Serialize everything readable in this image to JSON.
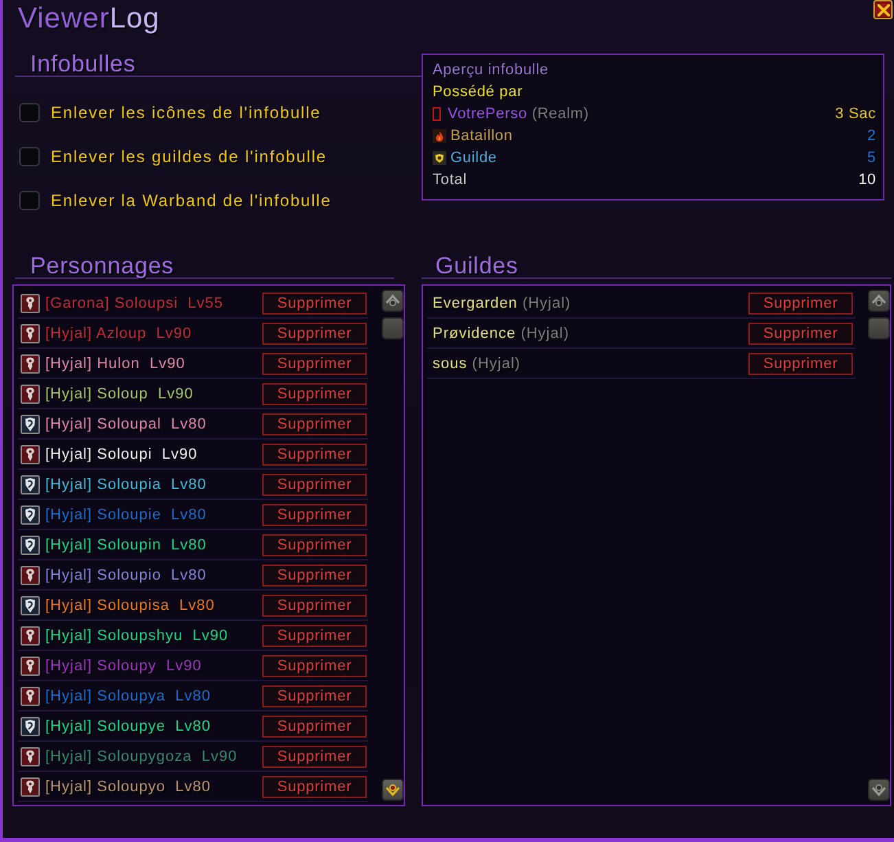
{
  "window": {
    "title": {
      "prefix": "Viewer",
      "suffix": "Log"
    }
  },
  "tooltip_options": {
    "heading": "Infobulles",
    "options": [
      {
        "label": "Enlever les icônes de l'infobulle",
        "checked": false
      },
      {
        "label": "Enlever les guildes de l'infobulle",
        "checked": false
      },
      {
        "label": "Enlever la Warband de l'infobulle",
        "checked": false
      }
    ]
  },
  "tooltip_preview": {
    "title": "Aperçu infobulle",
    "owned_by_label": "Possédé par",
    "rows": [
      {
        "kind": "character",
        "name": "VotrePerso",
        "realm": "(Realm)",
        "value": "3 Sac"
      },
      {
        "kind": "warband",
        "name": "Bataillon",
        "value": "2"
      },
      {
        "kind": "guild",
        "name": "Guilde",
        "value": "5"
      },
      {
        "kind": "total",
        "name": "Total",
        "value": "10"
      }
    ]
  },
  "characters": {
    "heading": "Personnages",
    "scroll_up": {
      "disabled": true
    },
    "scroll_down": {
      "disabled": false
    },
    "rows": [
      {
        "kind": "horde",
        "label": "[Garona] Soloupsi  Lv55",
        "color": "#c8283c",
        "button": "Supprimer"
      },
      {
        "kind": "horde",
        "label": "[Hyjal] Azloup  Lv90",
        "color": "#c8283c",
        "button": "Supprimer"
      },
      {
        "kind": "horde",
        "label": "[Hyjal] Hulon  Lv90",
        "color": "#e483b4",
        "button": "Supprimer"
      },
      {
        "kind": "horde",
        "label": "[Hyjal] Soloup  Lv90",
        "color": "#a2c964",
        "button": "Supprimer"
      },
      {
        "kind": "alliance",
        "label": "[Hyjal] Soloupal  Lv80",
        "color": "#e483b4",
        "button": "Supprimer"
      },
      {
        "kind": "horde",
        "label": "[Hyjal] Soloupi  Lv90",
        "color": "#f0f0f0",
        "button": "Supprimer"
      },
      {
        "kind": "alliance",
        "label": "[Hyjal] Soloupia  Lv80",
        "color": "#38bde4",
        "button": "Supprimer"
      },
      {
        "kind": "alliance",
        "label": "[Hyjal] Soloupie  Lv80",
        "color": "#116fd8",
        "button": "Supprimer"
      },
      {
        "kind": "alliance",
        "label": "[Hyjal] Soloupin  Lv80",
        "color": "#12d88e",
        "button": "Supprimer"
      },
      {
        "kind": "horde",
        "label": "[Hyjal] Soloupio  Lv80",
        "color": "#8283e2",
        "button": "Supprimer"
      },
      {
        "kind": "alliance",
        "label": "[Hyjal] Soloupisa  Lv80",
        "color": "#f07614",
        "button": "Supprimer"
      },
      {
        "kind": "horde",
        "label": "[Hyjal] Soloupshyu  Lv90",
        "color": "#12d88e",
        "button": "Supprimer"
      },
      {
        "kind": "horde",
        "label": "[Hyjal] Soloupy  Lv90",
        "color": "#a032c4",
        "button": "Supprimer"
      },
      {
        "kind": "horde",
        "label": "[Hyjal] Soloupya  Lv80",
        "color": "#116fd8",
        "button": "Supprimer"
      },
      {
        "kind": "alliance",
        "label": "[Hyjal] Soloupye  Lv80",
        "color": "#12d88e",
        "button": "Supprimer"
      },
      {
        "kind": "horde",
        "label": "[Hyjal] Soloupygoza  Lv90",
        "color": "#2f8a78",
        "button": "Supprimer"
      },
      {
        "kind": "horde",
        "label": "[Hyjal] Soloupyo  Lv80",
        "color": "#bb946c",
        "button": "Supprimer"
      }
    ]
  },
  "guilds": {
    "heading": "Guildes",
    "scroll_up": {
      "disabled": true
    },
    "scroll_down": {
      "disabled": true
    },
    "rows": [
      {
        "name": "Evergarden",
        "realm": "(Hyjal)",
        "button": "Supprimer"
      },
      {
        "name": "Prøvidence",
        "realm": "(Hyjal)",
        "button": "Supprimer"
      },
      {
        "name": "sous",
        "realm": "(Hyjal)",
        "button": "Supprimer"
      }
    ]
  }
}
